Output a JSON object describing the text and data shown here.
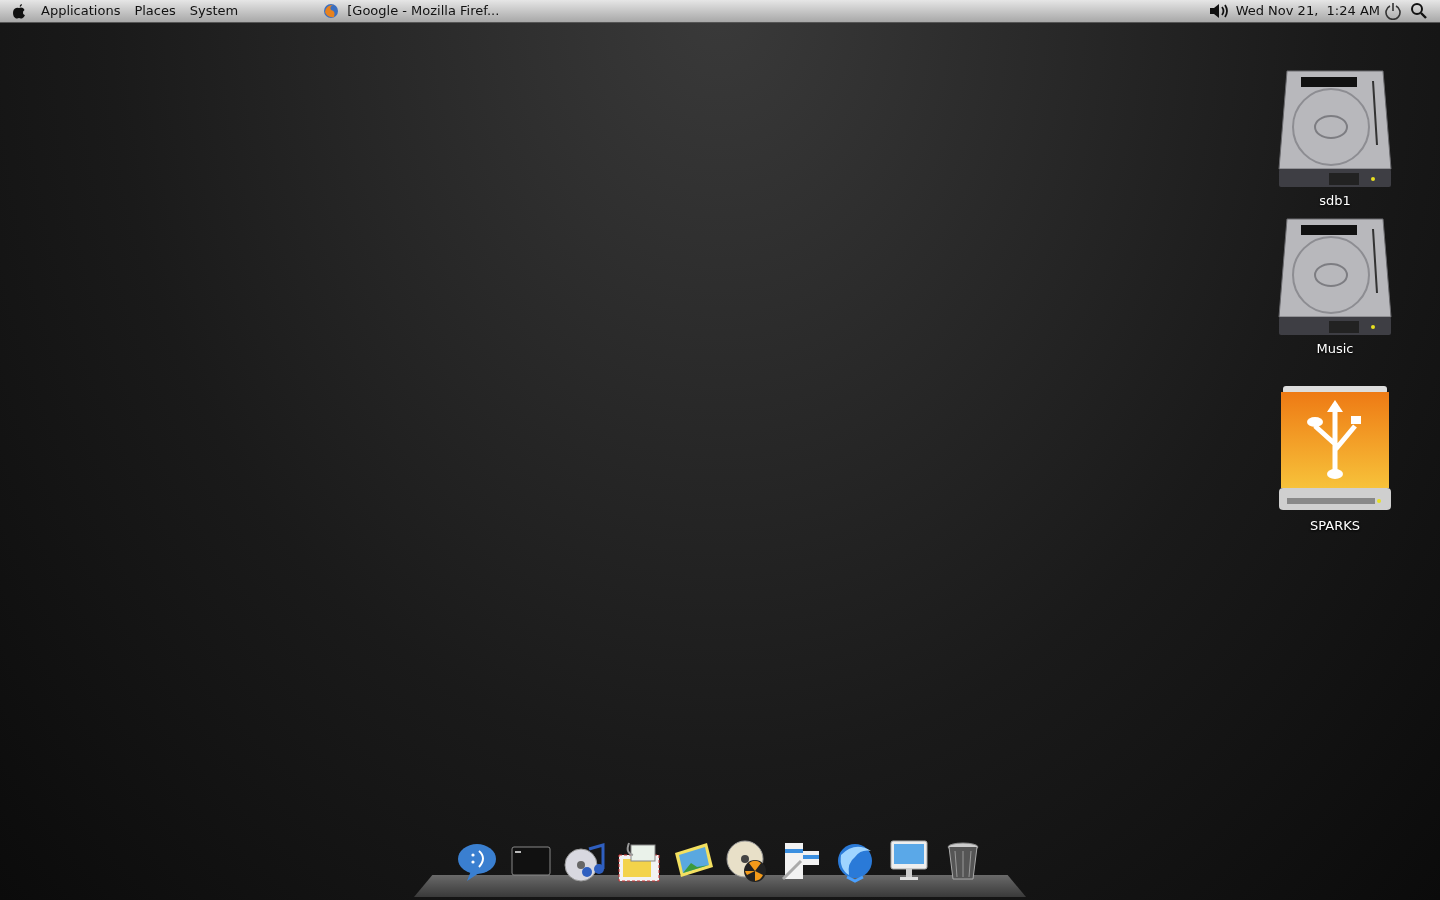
{
  "top_panel": {
    "menus": [
      {
        "label": "Applications"
      },
      {
        "label": "Places"
      },
      {
        "label": "System"
      }
    ],
    "taskbar_window": {
      "title": "[Google - Mozilla Firef..."
    },
    "clock": "Wed Nov 21,  1:24 AM"
  },
  "desktop_icons": [
    {
      "kind": "hdd",
      "label": "sdb1"
    },
    {
      "kind": "hdd",
      "label": "Music"
    },
    {
      "kind": "usb",
      "label": "SPARKS"
    }
  ],
  "dock": [
    {
      "kind": "chat"
    },
    {
      "kind": "terminal"
    },
    {
      "kind": "music"
    },
    {
      "kind": "mail"
    },
    {
      "kind": "photo"
    },
    {
      "kind": "burn"
    },
    {
      "kind": "editor"
    },
    {
      "kind": "browser"
    },
    {
      "kind": "monitor"
    },
    {
      "kind": "trash"
    }
  ]
}
